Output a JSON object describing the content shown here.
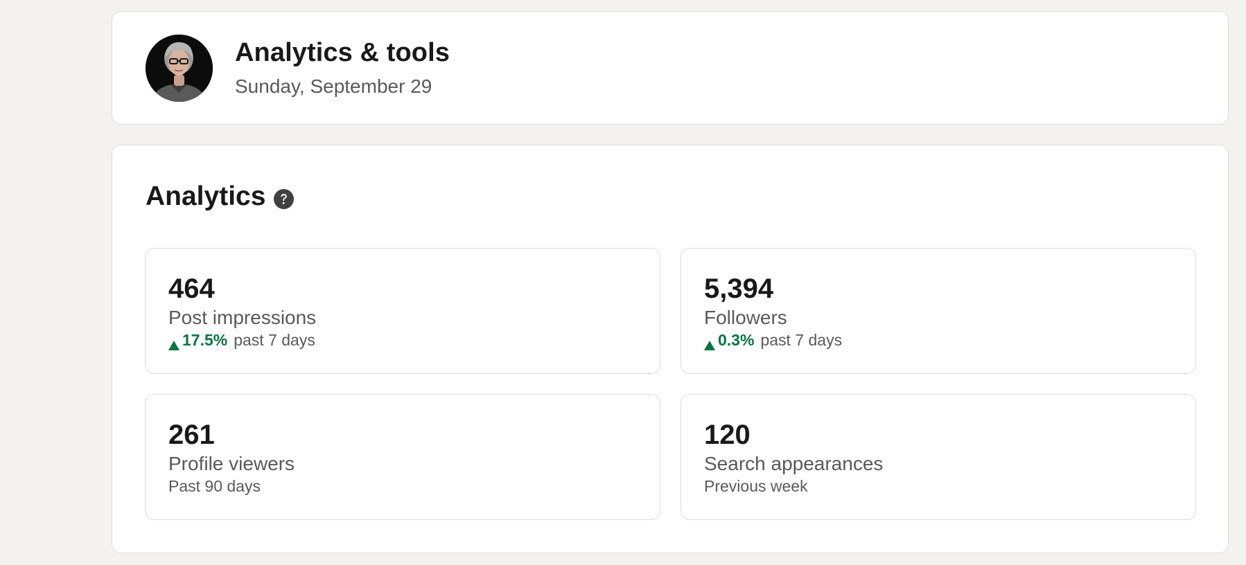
{
  "header": {
    "title": "Analytics & tools",
    "date": "Sunday, September 29",
    "avatar_icon": "profile-photo"
  },
  "analytics": {
    "title": "Analytics",
    "help_icon": "question-circle-icon",
    "trend_color": "#057642",
    "stats": [
      {
        "value": "464",
        "label": "Post impressions",
        "trend": "17.5%",
        "trend_direction": "up",
        "period": "past 7 days"
      },
      {
        "value": "5,394",
        "label": "Followers",
        "trend": "0.3%",
        "trend_direction": "up",
        "period": "past 7 days"
      },
      {
        "value": "261",
        "label": "Profile viewers",
        "period": "Past 90 days"
      },
      {
        "value": "120",
        "label": "Search appearances",
        "period": "Previous week"
      }
    ]
  }
}
